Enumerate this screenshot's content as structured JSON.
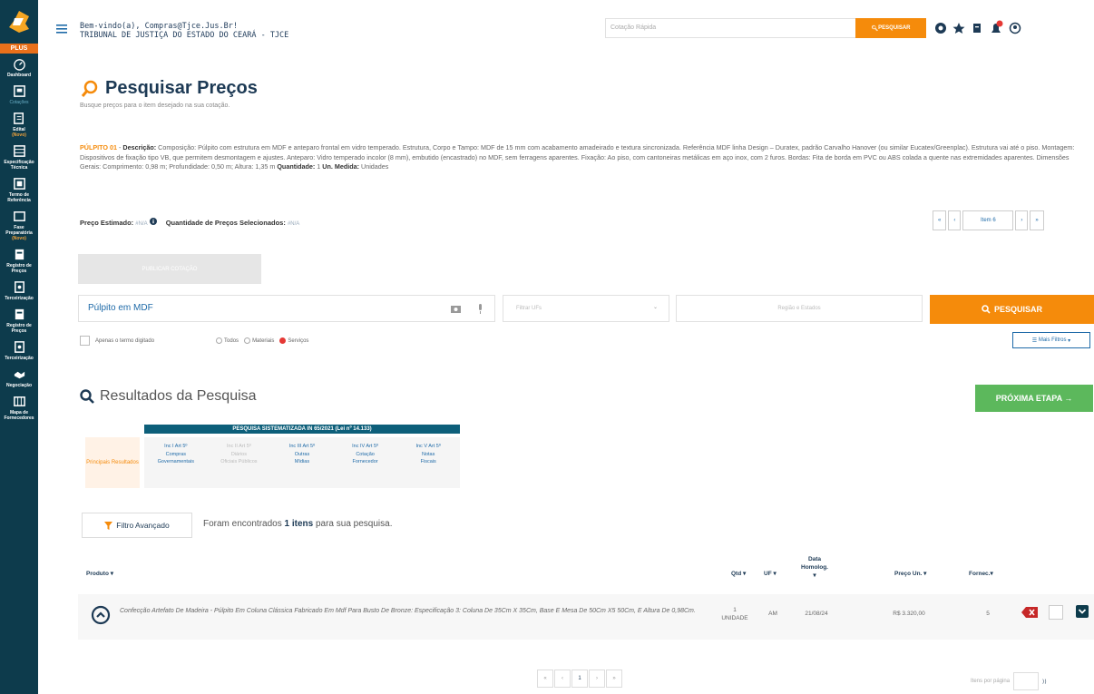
{
  "sidebar": {
    "plus_label": "PLUS",
    "items": [
      {
        "label": "Dashboard",
        "sub": "",
        "icon": "dashboard-icon"
      },
      {
        "label": "",
        "sub2": "Cotações",
        "icon": "quotes-icon"
      },
      {
        "label": "Edital",
        "sub": "(Novo)",
        "icon": "edital-icon"
      },
      {
        "label": "Especificação Técnica",
        "sub": "",
        "icon": "spec-icon"
      },
      {
        "label": "Termo de Referência",
        "sub": "",
        "icon": "reference-term-icon"
      },
      {
        "label": "Fase Preparatória",
        "sub": "(Novo)",
        "icon": "preparatory-phase-icon"
      },
      {
        "label": "Registro de Preços",
        "sub": "",
        "icon": "price-registry-icon"
      },
      {
        "label": "Terceirização",
        "sub": "",
        "icon": "outsourcing-icon"
      },
      {
        "label": "Registro de Preços",
        "sub": "",
        "icon": "price-registry-icon-2"
      },
      {
        "label": "Terceirização",
        "sub": "",
        "icon": "outsourcing-icon-2"
      },
      {
        "label": "Negociação",
        "sub": "",
        "icon": "negotiation-icon"
      },
      {
        "label": "Mapa de Fornecedores",
        "sub": "",
        "icon": "supplier-map-icon"
      }
    ]
  },
  "header": {
    "welcome_line1": "Bem-vindo(a), Compras@Tjce.Jus.Br!",
    "welcome_line2": "TRIBUNAL DE JUSTIÇA DO ESTADO DO CEARÁ - TJCE",
    "search_placeholder": "Cotação Rápida",
    "search_button": "PESQUISAR"
  },
  "page": {
    "title": "Pesquisar Preços",
    "subtitle": "Busque preços para o item desejado na sua cotação."
  },
  "item": {
    "code": "PÚLPITO 01",
    "description_label": "Descrição:",
    "description": "Composição: Púlpito com estrutura em MDF e anteparo frontal em vidro temperado. Estrutura, Corpo e Tampo: MDF de 15 mm com acabamento amadeirado e textura sincronizada. Referência MDF linha Design – Duratex, padrão Carvalho Hanover (ou similar Eucatex/Greenplac). Estrutura vai até o piso. Montagem: Dispositivos de fixação tipo VB, que permitem desmontagem e ajustes. Anteparo: Vidro temperado incolor (8 mm), embutido (encastrado) no MDF, sem ferragens aparentes. Fixação: Ao piso, com cantoneiras metálicas em aço inox, com 2 furos. Bordas: Fita de borda em PVC ou ABS colada a quente nas extremidades aparentes. Dimensões Gerais: Comprimento: 0,98 m; Profundidade: 0,50 m; Altura: 1,35 m",
    "quantity_label": "Quantidade:",
    "quantity": "1",
    "unit_label": "Un. Medida:",
    "unit": "Unidades",
    "estimated_label": "Preço Estimado:",
    "estimated_value": "#N/A",
    "selected_label": "Quantidade de Preços Selecionados:",
    "selected_value": "#N/A"
  },
  "pager_top": {
    "first": "«",
    "prev": "‹",
    "current": "Item 6",
    "next": "›",
    "last": "»"
  },
  "disabled_button": "PUBLICAR COTAÇÃO",
  "search": {
    "query": "Púlpito em MDF",
    "uf_placeholder": "Filtrar UFs",
    "region_placeholder": "Região e Estados",
    "button": "PESQUISAR",
    "only_term": "Apenas o termo digitado",
    "radio_all": "Todos",
    "radio_materials": "Materiais",
    "radio_services": "Serviços",
    "more_filters": "Mais Filtros"
  },
  "results": {
    "title": "Resultados da Pesquisa",
    "next_step": "PRÓXIMA ETAPA →",
    "sys_header": "PESQUISA SISTEMATIZADA IN 65/2021 (Lei nº 14.133)",
    "sys_left": "Principais Resultados",
    "sys_cols": [
      {
        "line1": "Inc I Art 5º",
        "line2": "Compras",
        "line3": "Governamentais",
        "dim": false
      },
      {
        "line1": "Inc II Art 5º",
        "line2": "Diários",
        "line3": "Oficiais Públicos",
        "dim": true
      },
      {
        "line1": "Inc III Art 5º",
        "line2": "Outras",
        "line3": "Mídias",
        "dim": false
      },
      {
        "line1": "Inc IV Art 5º",
        "line2": "Cotação",
        "line3": "Fornecedor",
        "dim": false
      },
      {
        "line1": "Inc V Art 5º",
        "line2": "Notas",
        "line3": "Fiscais",
        "dim": false
      }
    ],
    "advanced_filter": "Filtro Avançado",
    "found_prefix": "Foram encontrados",
    "found_count": "1 itens",
    "found_suffix": "para sua pesquisa."
  },
  "table": {
    "headers": {
      "product": "Produto ▾",
      "qty": "Qtd ▾",
      "uf": "UF ▾",
      "date_line1": "Data",
      "date_line2": "Homolog.",
      "date_line3": "▾",
      "price": "Preço Un. ▾",
      "suppliers": "Fornec.▾"
    },
    "rows": [
      {
        "product": "Confecção Artefato De Madeira - Púlpito Em Coluna Clássica Fabricado Em Mdf Para Busto De Bronze: Especificação 3: Coluna De 35Cm X 35Cm, Base E Mesa De 50Cm X5 50Cm, E Altura De 0,98Cm.",
        "qty": "1",
        "unit": "UNIDADE",
        "uf": "AM",
        "date": "21/08/24",
        "price": "R$ 3.320,00",
        "suppliers": "5"
      }
    ]
  },
  "pager_bottom": [
    "«",
    "‹",
    "1",
    "›",
    "»"
  ],
  "per_page_label": "Itens por página",
  "colors": {
    "sidebar": "#0d3b4c",
    "accent": "#f58b0b",
    "navy": "#1d3a55",
    "success": "#5cb85c"
  }
}
